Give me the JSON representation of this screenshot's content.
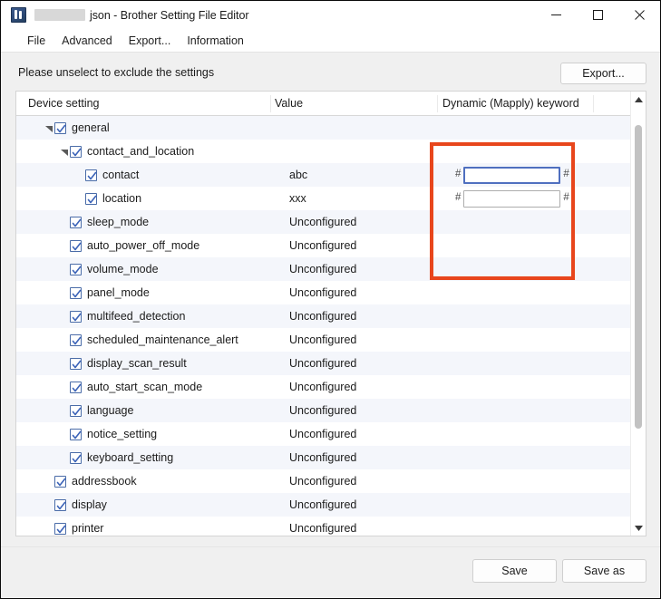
{
  "window": {
    "icon": "app-icon",
    "title_redacted_prefix": "",
    "title": "json - Brother Setting File Editor",
    "controls": {
      "minimize": "minimize-icon",
      "maximize": "maximize-icon",
      "close": "close-icon"
    }
  },
  "menubar": {
    "items": [
      {
        "label": "File"
      },
      {
        "label": "Advanced"
      },
      {
        "label": "Export..."
      },
      {
        "label": "Information"
      }
    ]
  },
  "toolbar": {
    "hint": "Please unselect to exclude the settings",
    "export_label": "Export..."
  },
  "table": {
    "columns": [
      {
        "key": "device_setting",
        "label": "Device setting"
      },
      {
        "key": "value",
        "label": "Value"
      },
      {
        "key": "dynamic_keyword",
        "label": "Dynamic (Mapply) keyword"
      }
    ],
    "rows": [
      {
        "label": "general",
        "value": "",
        "level": 0,
        "expanded": true,
        "checked": true,
        "has_twisty": true,
        "keyword": null
      },
      {
        "label": "contact_and_location",
        "value": "",
        "level": 1,
        "expanded": true,
        "checked": true,
        "has_twisty": true,
        "keyword": null
      },
      {
        "label": "contact",
        "value": "abc",
        "level": 2,
        "expanded": false,
        "checked": true,
        "has_twisty": false,
        "keyword": {
          "value": "",
          "prefix": "#",
          "suffix": "#",
          "focused": true
        }
      },
      {
        "label": "location",
        "value": "xxx",
        "level": 2,
        "expanded": false,
        "checked": true,
        "has_twisty": false,
        "keyword": {
          "value": "",
          "prefix": "#",
          "suffix": "#",
          "focused": false
        }
      },
      {
        "label": "sleep_mode",
        "value": "Unconfigured",
        "level": 1,
        "expanded": false,
        "checked": true,
        "has_twisty": false,
        "keyword": null
      },
      {
        "label": "auto_power_off_mode",
        "value": "Unconfigured",
        "level": 1,
        "expanded": false,
        "checked": true,
        "has_twisty": false,
        "keyword": null
      },
      {
        "label": "volume_mode",
        "value": "Unconfigured",
        "level": 1,
        "expanded": false,
        "checked": true,
        "has_twisty": false,
        "keyword": null
      },
      {
        "label": "panel_mode",
        "value": "Unconfigured",
        "level": 1,
        "expanded": false,
        "checked": true,
        "has_twisty": false,
        "keyword": null
      },
      {
        "label": "multifeed_detection",
        "value": "Unconfigured",
        "level": 1,
        "expanded": false,
        "checked": true,
        "has_twisty": false,
        "keyword": null
      },
      {
        "label": "scheduled_maintenance_alert",
        "value": "Unconfigured",
        "level": 1,
        "expanded": false,
        "checked": true,
        "has_twisty": false,
        "keyword": null
      },
      {
        "label": "display_scan_result",
        "value": "Unconfigured",
        "level": 1,
        "expanded": false,
        "checked": true,
        "has_twisty": false,
        "keyword": null
      },
      {
        "label": "auto_start_scan_mode",
        "value": "Unconfigured",
        "level": 1,
        "expanded": false,
        "checked": true,
        "has_twisty": false,
        "keyword": null
      },
      {
        "label": "language",
        "value": "Unconfigured",
        "level": 1,
        "expanded": false,
        "checked": true,
        "has_twisty": false,
        "keyword": null
      },
      {
        "label": "notice_setting",
        "value": "Unconfigured",
        "level": 1,
        "expanded": false,
        "checked": true,
        "has_twisty": false,
        "keyword": null
      },
      {
        "label": "keyboard_setting",
        "value": "Unconfigured",
        "level": 1,
        "expanded": false,
        "checked": true,
        "has_twisty": false,
        "keyword": null
      },
      {
        "label": "addressbook",
        "value": "Unconfigured",
        "level": 0,
        "expanded": false,
        "checked": true,
        "has_twisty": false,
        "keyword": null
      },
      {
        "label": "display",
        "value": "Unconfigured",
        "level": 0,
        "expanded": false,
        "checked": true,
        "has_twisty": false,
        "keyword": null
      },
      {
        "label": "printer",
        "value": "Unconfigured",
        "level": 0,
        "expanded": false,
        "checked": true,
        "has_twisty": false,
        "keyword": null
      }
    ]
  },
  "scrollbar": {
    "up_arrow": "scroll-up-icon",
    "down_arrow": "scroll-down-icon",
    "thumb_position_pct": 0,
    "thumb_size_pct": 73
  },
  "highlight": {
    "color": "#e8461c",
    "target_column": "Dynamic (Mapply) keyword"
  },
  "footer": {
    "save_label": "Save",
    "save_as_label": "Save as"
  }
}
